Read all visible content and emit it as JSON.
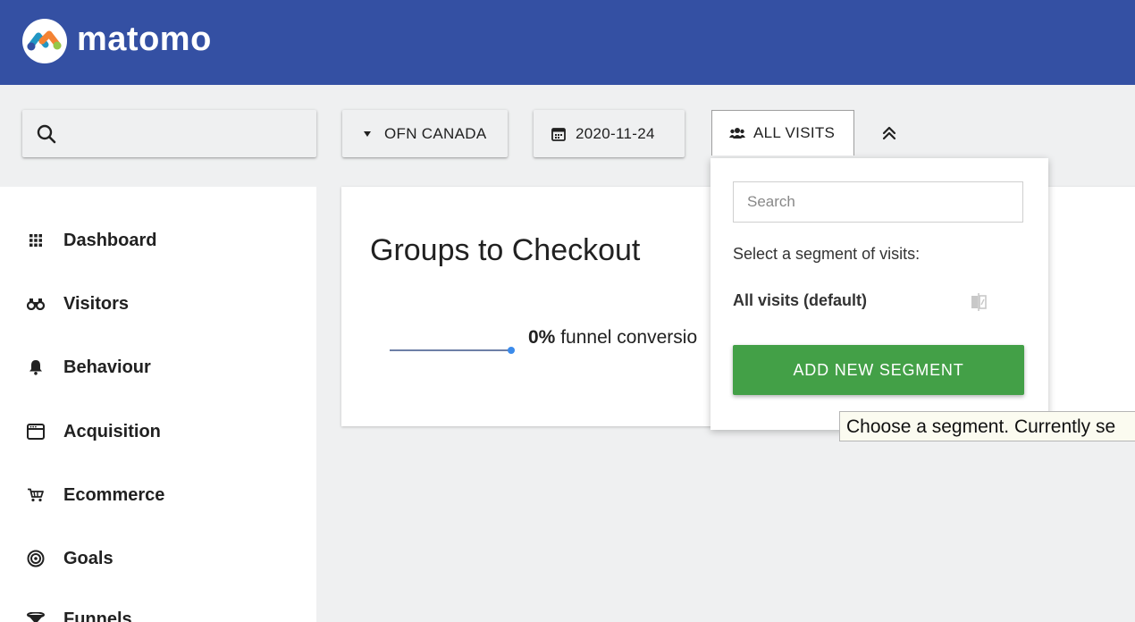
{
  "brand": {
    "name": "matomo"
  },
  "toolbar": {
    "search_placeholder": "",
    "site": "OFN CANADA",
    "date": "2020-11-24",
    "segment": "ALL VISITS"
  },
  "sidebar": {
    "items": [
      {
        "label": "Dashboard",
        "icon": "grid-icon"
      },
      {
        "label": "Visitors",
        "icon": "binoculars-icon"
      },
      {
        "label": "Behaviour",
        "icon": "bell-icon"
      },
      {
        "label": "Acquisition",
        "icon": "browser-window-icon"
      },
      {
        "label": "Ecommerce",
        "icon": "shopping-cart-icon"
      },
      {
        "label": "Goals",
        "icon": "target-icon"
      },
      {
        "label": "Funnels",
        "icon": "funnel-icon"
      }
    ]
  },
  "card": {
    "title": "Groups to Checkout",
    "conversion_value": "0%",
    "conversion_label": "funnel conversio"
  },
  "segment_panel": {
    "search_placeholder": "Search",
    "prompt": "Select a segment of visits:",
    "default_segment": "All visits (default)",
    "add_button": "ADD NEW SEGMENT"
  },
  "tooltip": {
    "text": "Choose a segment. Currently se"
  },
  "colors": {
    "header": "#3450a3",
    "add_button": "#43a047",
    "background": "#eff0f1"
  }
}
